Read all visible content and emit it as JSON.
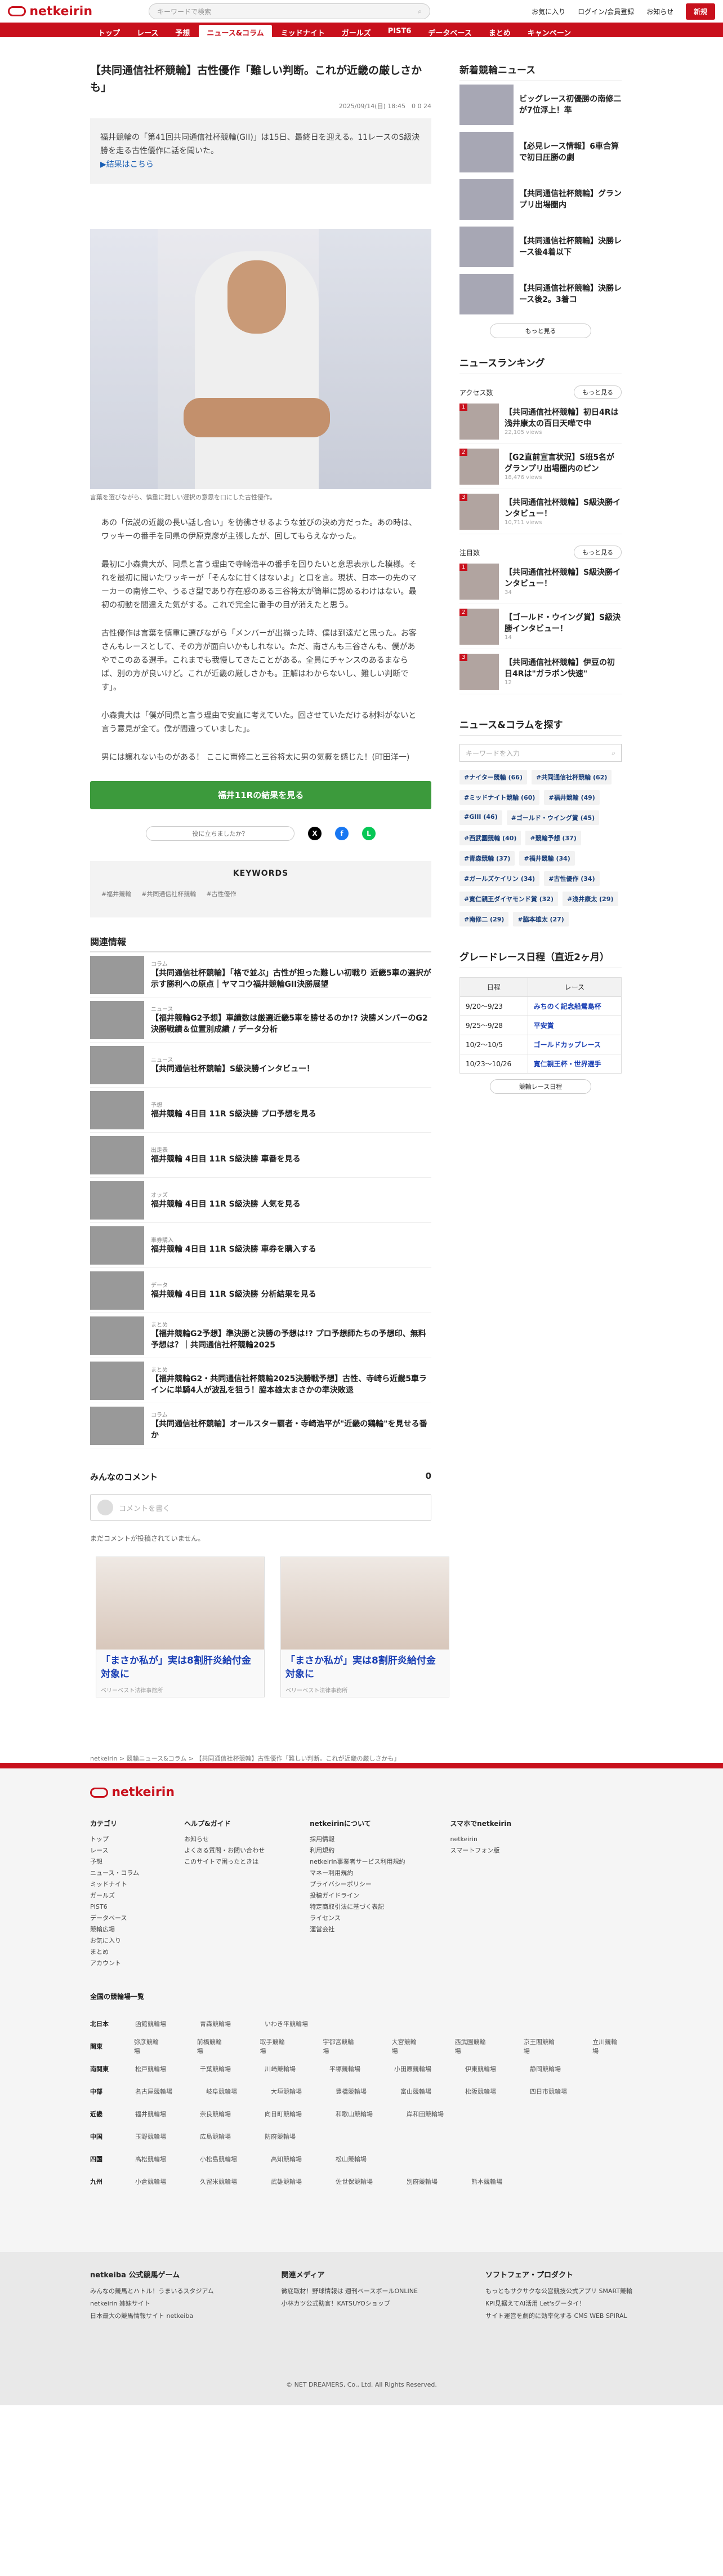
{
  "header": {
    "logo": "netkeirin",
    "search_placeholder": "キーワードで検索",
    "favorites": "お気に入り",
    "login": "ログイン/会員登録",
    "notice": "お知らせ",
    "premium": "新規"
  },
  "nav": [
    "トップ",
    "レース",
    "予想",
    "ニュース&コラム",
    "ミッドナイト",
    "ガールズ",
    "PIST6",
    "データベース",
    "まとめ",
    "キャンペーン"
  ],
  "article": {
    "title": "【共同通信社杯競輪】古性優作「難しい判断。これが近畿の厳しさかも」",
    "date": "2025/09/14(日) 18:45",
    "counts": "0   0   24",
    "lead": "福井競輪の「第41回共同通信社杯競輪(GII)」は15日、最終日を迎える。11レースのS級決勝を走る古性優作に話を聞いた。",
    "lead_link": "▶結果はこちら",
    "photo_caption": "言葉を選びながら、慎重に難しい選択の意思を口にした古性優作。",
    "paragraphs": [
      "あの「伝説の近畿の長い話し合い」を彷彿させるような並びの決め方だった。あの時は、ワッキーの番手を同県の伊原克彦が主張したが、回してもらえなかった。",
      "最初に小森貴大が、同県と言う理由で寺崎浩平の番手を回りたいと意思表示した模様。それを最初に聞いたワッキーが「そんなに甘くはないよ」と口を言。現状、日本一の先のマーカーの南修二や、うるさ型であり存在感のある三谷将太が簡単に認めるわけはない。最初の初動を間違えた気がする。これで完全に番手の目が消えたと思う。",
      "古性優作は言葉を慎重に選びながら「メンバーが出揃った時、僕は到達だと思った。お客さんもレースとして、その方が面白いかもしれない。ただ、南さんも三谷さんも、僕があやでこのある選手。これまでも我慢してきたことがある。全員にチャンスのあるまならば、別の方が良いけど。これが近畿の厳しさかも。正解はわからないし、難しい判断です」。",
      "小森貴大は「僕が同県と言う理由で安直に考えていた。回させていただける材料がないと言う意見が全て。僕が間違っていました」。",
      "男には譲れないものがある！ ここに南修二と三谷将太に男の気概を感じた！(町田洋一)"
    ],
    "cta": "福井11Rの結果を見る",
    "share_question": "役に立ちましたか？",
    "keywords_title": "KEYWORDS",
    "keywords": [
      "#福井競輪",
      "#共同通信社杯競輪",
      "#古性優作"
    ]
  },
  "related_title": "関連情報",
  "related": [
    {
      "cat": "コラム",
      "title": "【共同通信社杯競輪】「格で並ぶ」古性が担った難しい初戦り 近畿5車の選択が示す勝利への原点｜ヤマコウ福井競輪GII決勝展望"
    },
    {
      "cat": "ニュース",
      "title": "【福井競輪G2予想】車績数は厳選近畿5車を勝せるのか!? 決勝メンバーのG2決勝戦績＆位置別成績 / データ分析"
    },
    {
      "cat": "ニュース",
      "title": "【共同通信社杯競輪】S級決勝インタビュー！"
    },
    {
      "cat": "予想",
      "title": "福井競輪 4日目 11R S級決勝 プロ予想を見る"
    },
    {
      "cat": "出走表",
      "title": "福井競輪 4日目 11R S級決勝 車番を見る"
    },
    {
      "cat": "オッズ",
      "title": "福井競輪 4日目 11R S級決勝 人気を見る"
    },
    {
      "cat": "車券購入",
      "title": "福井競輪 4日目 11R S級決勝 車券を購入する"
    },
    {
      "cat": "データ",
      "title": "福井競輪 4日目 11R S級決勝 分析結果を見る"
    },
    {
      "cat": "まとめ",
      "title": "【福井競輪G2予想】準決勝と決勝の予想は!? プロ予想師たちの予想印、無料予想は？｜共同通信社杯競輪2025"
    },
    {
      "cat": "まとめ",
      "title": "【福井競輪G2・共同通信社杯競輪2025決勝戦予想】古性、寺崎ら近畿5車ラインに単騎4人が波乱を狙う！脇本雄太まさかの準決敗退"
    },
    {
      "cat": "コラム",
      "title": "【共同通信社杯競輪】オールスター覇者・寺崎浩平が\"近畿の鶏輪\"を見せる番か"
    }
  ],
  "comments": {
    "title": "みんなのコメント",
    "count": "0",
    "placeholder": "コメントを書く",
    "none": "まだコメントが投稿されていません。"
  },
  "ads": [
    {
      "title": "「まさか私が」実は8割肝炎給付金対象に",
      "sponsor": "ベリーベスト法律事務所"
    },
    {
      "title": "「まさか私が」実は8割肝炎給付金対象に",
      "sponsor": "ベリーベスト法律事務所"
    }
  ],
  "side": {
    "new_title": "新着競輪ニュース",
    "news": [
      "ビッグレース初優勝の南修二が7位浮上！準",
      "【必見レース情報】6車合算で初日圧勝の劇",
      "【共同通信社杯競輪】グランプリ出場圏内",
      "【共同通信社杯競輪】決勝レース後4着以下",
      "【共同通信社杯競輪】決勝レース後2。3着コ"
    ],
    "more": "もっと見る",
    "ranking_title": "ニュースランキング",
    "access": "アクセス数",
    "more_btn": "もっと見る",
    "rank": [
      {
        "t": "【共同通信社杯競輪】初日4Rは浅井康太の百日天嘩で中",
        "c": "22,105 views"
      },
      {
        "t": "【G2直前宣言状況】S班5名がグランプリ出場圏内のピン",
        "c": "18,476 views"
      },
      {
        "t": "【共同通信社杯競輪】S級決勝インタビュー！",
        "c": "10,711 views"
      }
    ],
    "attn": "注目数",
    "rank2": [
      {
        "t": "【共同通信社杯競輪】S級決勝インタビュー！",
        "c": "34"
      },
      {
        "t": "【ゴールド・ウイング賞】S級決勝インタビュー！",
        "c": "14"
      },
      {
        "t": "【共同通信社杯競輪】伊豆の初日4Rは\"ガラポン快速\"",
        "c": "12"
      }
    ],
    "find_title": "ニュース&コラムを探す",
    "find_placeholder": "キーワードを入力",
    "tags": [
      "#ナイター競輪 (66)",
      "#共同通信社杯競輪 (62)",
      "#ミッドナイト競輪 (60)",
      "#福井競輪 (49)",
      "#GIII (46)",
      "#ゴールド・ウイング賞 (45)",
      "#西武園競輪 (40)",
      "#競輪予想 (37)",
      "#青森競輪 (37)",
      "#福井競輪 (34)",
      "#ガールズケイリン (34)",
      "#古性優作 (34)",
      "#寛仁親王ダイヤモンド賞 (32)",
      "#浅井康太 (29)",
      "#南修二 (29)",
      "#脇本雄太 (27)"
    ],
    "grade_title": "グレードレース日程（直近2ヶ月）",
    "grade_head": [
      "日程",
      "レース"
    ],
    "grade": [
      [
        "9/20〜9/23",
        "みちのく記念船鶯島杯"
      ],
      [
        "9/25〜9/28",
        "平安賞"
      ],
      [
        "10/2〜10/5",
        "ゴールドカップレース"
      ],
      [
        "10/23〜10/26",
        "寛仁親王杯・世界選手"
      ]
    ],
    "grade_more": "競輪レース日程"
  },
  "breadcrumb": "netkeirin  >  競輪ニュース&コラム  >  【共同通信社杯競輪】古性優作「難しい判断。これが近畿の厳しさかも」",
  "footer": {
    "cols": [
      {
        "h": "カテゴリ",
        "items": [
          "トップ",
          "レース",
          "予想",
          "ニュース・コラム",
          "ミッドナイト",
          "ガールズ",
          "PIST6",
          "データベース",
          "競輪広場",
          "お気に入り",
          "まとめ",
          "アカウント"
        ]
      },
      {
        "h": "ヘルプ&ガイド",
        "items": [
          "お知らせ",
          "よくある質問・お問い合わせ",
          "このサイトで困ったときは"
        ]
      },
      {
        "h": "netkeirinについて",
        "items": [
          "採用情報",
          "利用規約",
          "netkeirin事業者サービス利用規約",
          "マネー利用規約",
          "プライバシーポリシー",
          "投稿ガイドライン",
          "特定商取引法に基づく表記",
          "ライセンス",
          "運営会社"
        ]
      },
      {
        "h": "スマホでnetkeirin",
        "items": [
          "netkeirin",
          "スマートフォン版"
        ]
      }
    ],
    "regions_title": "全国の競輪場一覧",
    "regions": [
      [
        "北日本",
        "函館競輪場",
        "青森競輪場",
        "いわき平競輪場"
      ],
      [
        "関東",
        "弥彦競輪場",
        "前橋競輪場",
        "取手競輪場",
        "宇都宮競輪場",
        "大宮競輪場",
        "西武園競輪場",
        "京王閣競輪場",
        "立川競輪場"
      ],
      [
        "南関東",
        "松戸競輪場",
        "千葉競輪場",
        "川崎競輪場",
        "平塚競輪場",
        "小田原競輪場",
        "伊東競輪場",
        "静岡競輪場"
      ],
      [
        "中部",
        "名古屋競輪場",
        "岐阜競輪場",
        "大垣競輪場",
        "豊橋競輪場",
        "富山競輪場",
        "松阪競輪場",
        "四日市競輪場"
      ],
      [
        "近畿",
        "福井競輪場",
        "奈良競輪場",
        "向日町競輪場",
        "和歌山競輪場",
        "岸和田競輪場"
      ],
      [
        "中国",
        "玉野競輪場",
        "広島競輪場",
        "防府競輪場"
      ],
      [
        "四国",
        "高松競輪場",
        "小松島競輪場",
        "高知競輪場",
        "松山競輪場"
      ],
      [
        "九州",
        "小倉競輪場",
        "久留米競輪場",
        "武雄競輪場",
        "佐世保競輪場",
        "別府競輪場",
        "熊本競輪場"
      ]
    ],
    "b2": [
      {
        "h": "netkeiba 公式競馬ゲーム",
        "items": [
          "みんなの競馬とハトル！うまいるスタジアム",
          "netkeirin 姉妹サイト",
          "日本最大の競馬情報サイト netkeiba"
        ]
      },
      {
        "h": "関連メディア",
        "items": [
          "微底取材！野球情報は 週刊ベースボールONLINE",
          "小林カツ公式助言！KATSUYOショップ"
        ]
      },
      {
        "h": "ソフトフェア・プロダクト",
        "items": [
          "もっともサクサクな公営競技公式アプリ SMART競輪",
          "KPI見据えてAI活用 Let'sグータイ！",
          "サイト運営を劇的に効率化する CMS WEB SPIRAL"
        ]
      }
    ],
    "copyright": "© NET DREAMERS, Co., Ltd. All Rights Reserved."
  }
}
